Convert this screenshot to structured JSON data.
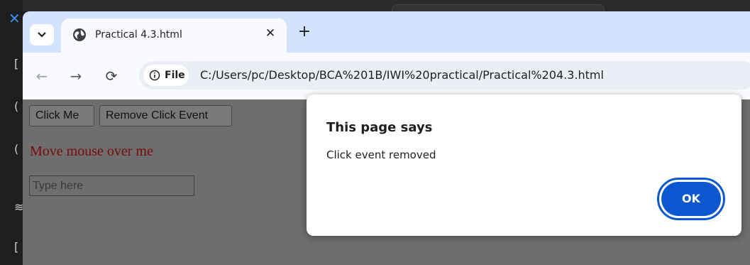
{
  "browser": {
    "tab": {
      "title": "Practical 4.3.html",
      "close_glyph": "✕"
    },
    "new_tab_glyph": "+",
    "tab_search_icon": "chevron-down-icon",
    "nav": {
      "back_glyph": "←",
      "forward_glyph": "→",
      "reload_glyph": "⟳"
    },
    "address": {
      "chip_label": "File",
      "url": "C:/Users/pc/Desktop/BCA%201B/IWI%20practical/Practical%204.3.html"
    }
  },
  "page": {
    "click_button_label": "Click Me",
    "remove_button_label": "Remove Click Event",
    "hover_text": "Move mouse over me",
    "input_placeholder": "Type here",
    "hover_text_color": "#7a0b0b"
  },
  "alert": {
    "title": "This page says",
    "message": "Click event removed",
    "ok_label": "OK",
    "accent_color": "#0b57d0"
  }
}
